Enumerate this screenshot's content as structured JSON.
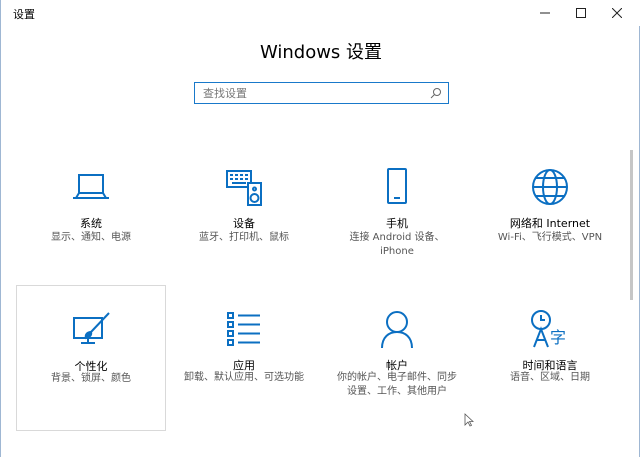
{
  "window": {
    "title": "设置",
    "min_glyph": "—",
    "max_glyph": "☐",
    "close_glyph": "✕"
  },
  "heading": "Windows 设置",
  "search": {
    "placeholder": "查找设置"
  },
  "accent_color": "#0b6fc2",
  "tiles": [
    {
      "name": "系统",
      "desc": "显示、通知、电源",
      "icon": "laptop-icon"
    },
    {
      "name": "设备",
      "desc": "蓝牙、打印机、鼠标",
      "icon": "keyboard-speaker-icon"
    },
    {
      "name": "手机",
      "desc": "连接 Android 设备、\niPhone",
      "icon": "phone-icon"
    },
    {
      "name": "网络和 Internet",
      "desc": "Wi-Fi、飞行模式、VPN",
      "icon": "globe-icon"
    },
    {
      "name": "个性化",
      "desc": "背景、锁屏、颜色",
      "icon": "paintbrush-screen-icon"
    },
    {
      "name": "应用",
      "desc": "卸载、默认应用、可选功能",
      "icon": "list-icon"
    },
    {
      "name": "帐户",
      "desc": "你的帐户、电子邮件、同步\n设置、工作、其他用户",
      "icon": "person-icon"
    },
    {
      "name": "时间和语言",
      "desc": "语音、区域、日期",
      "icon": "time-language-icon"
    }
  ]
}
